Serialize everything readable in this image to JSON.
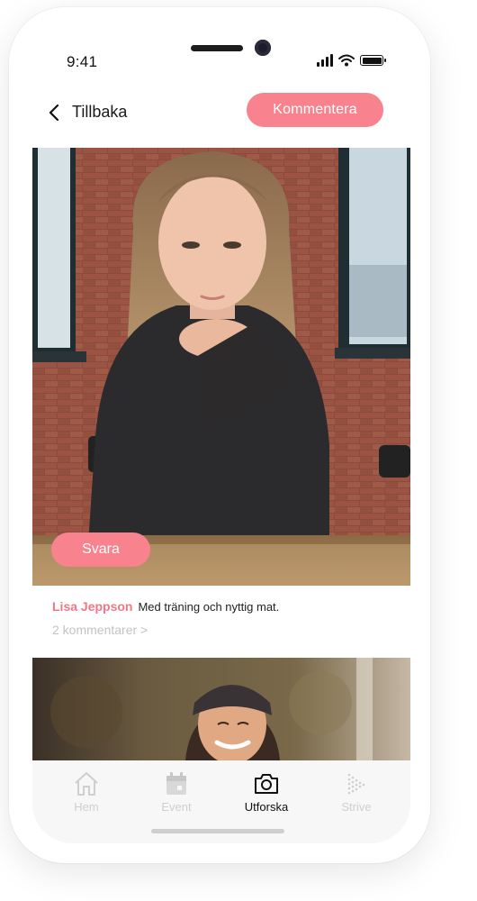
{
  "status_bar": {
    "time": "9:41"
  },
  "header": {
    "back_label": "Tillbaka",
    "comment_button": "Kommentera"
  },
  "post": {
    "reply_button": "Svara",
    "author": "Lisa Jeppson",
    "text": "Med träning och nyttig mat.",
    "comments_link": "2 kommentarer >"
  },
  "tabs": [
    {
      "label": "Hem",
      "icon": "home-icon",
      "active": false
    },
    {
      "label": "Event",
      "icon": "calendar-icon",
      "active": false
    },
    {
      "label": "Utforska",
      "icon": "camera-icon",
      "active": true
    },
    {
      "label": "Strive",
      "icon": "strive-logo-icon",
      "active": false
    }
  ],
  "colors": {
    "accent": "#f8838f",
    "author": "#f07884",
    "muted": "#c3c3c3",
    "tabbar_bg": "#f7f7f7"
  }
}
